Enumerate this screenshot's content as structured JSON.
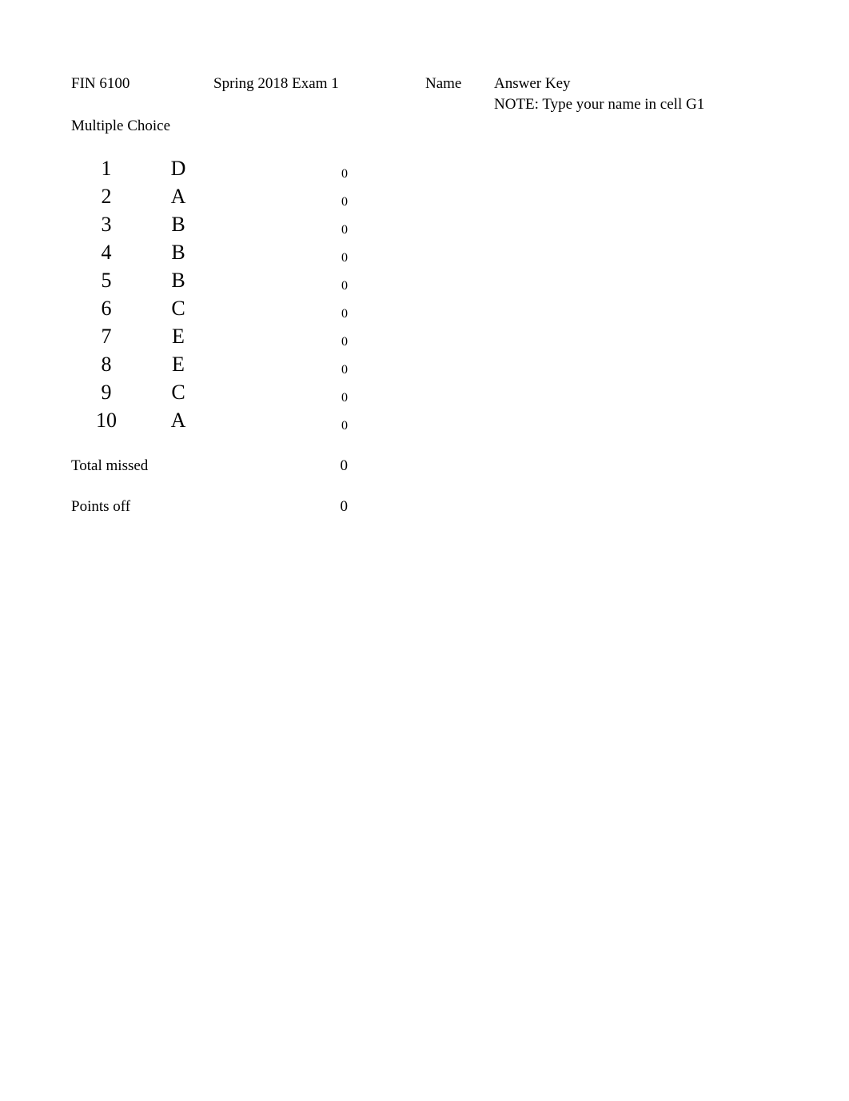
{
  "header": {
    "course": "FIN 6100",
    "exam": "Spring 2018 Exam 1",
    "name_label": "Name",
    "name_value": "Answer Key",
    "note": "NOTE: Type your name in cell G1"
  },
  "section": {
    "label": "Multiple Choice"
  },
  "answer_table": {
    "rows": [
      {
        "number": "1",
        "answer": "D",
        "score": "0"
      },
      {
        "number": "2",
        "answer": "A",
        "score": "0"
      },
      {
        "number": "3",
        "answer": "B",
        "score": "0"
      },
      {
        "number": "4",
        "answer": "B",
        "score": "0"
      },
      {
        "number": "5",
        "answer": "B",
        "score": "0"
      },
      {
        "number": "6",
        "answer": "C",
        "score": "0"
      },
      {
        "number": "7",
        "answer": "E",
        "score": "0"
      },
      {
        "number": "8",
        "answer": "E",
        "score": "0"
      },
      {
        "number": "9",
        "answer": "C",
        "score": "0"
      },
      {
        "number": "10",
        "answer": "A",
        "score": "0"
      }
    ]
  },
  "totals": {
    "total_missed_label": "Total missed",
    "total_missed_value": "0",
    "points_off_label": "Points off",
    "points_off_value": "0"
  }
}
